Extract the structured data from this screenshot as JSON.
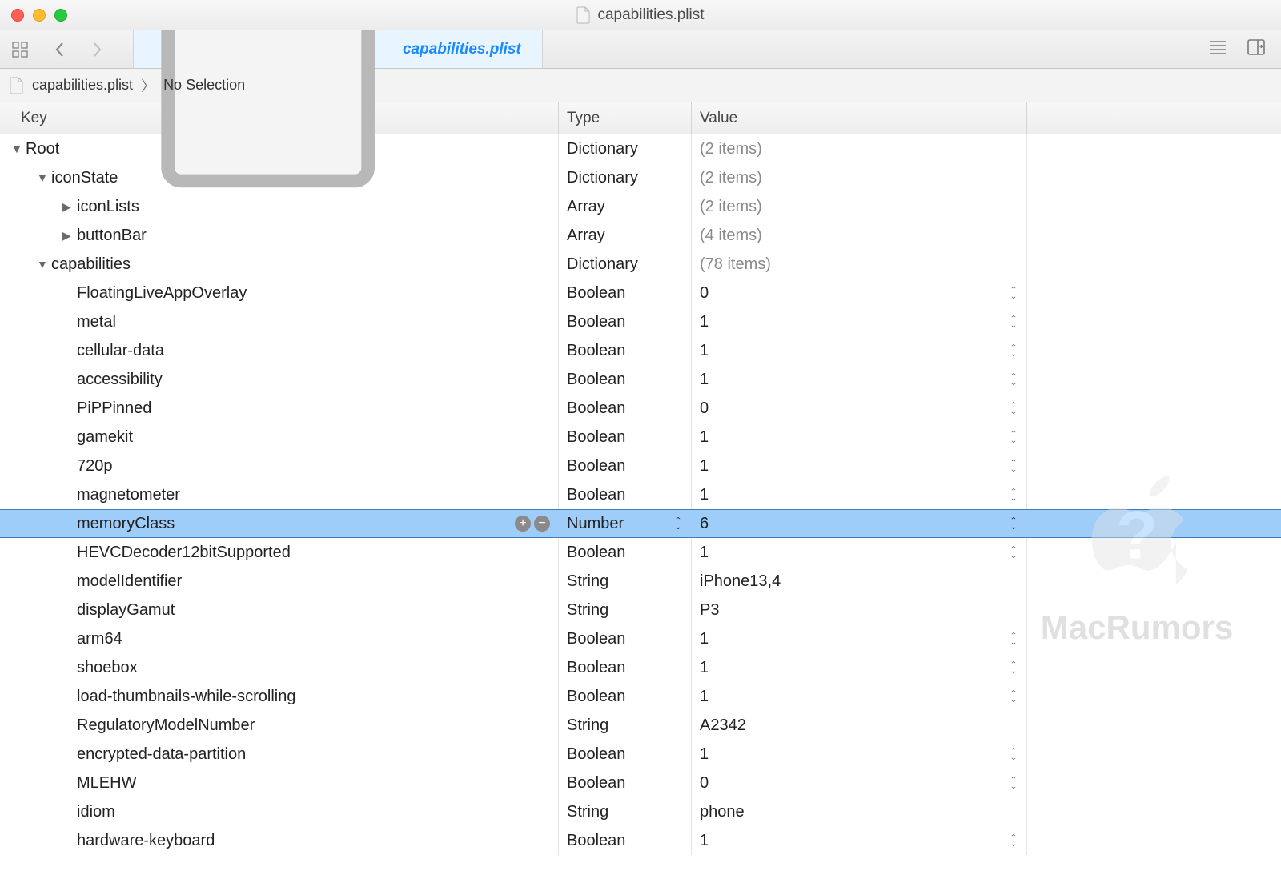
{
  "window": {
    "title": "capabilities.plist"
  },
  "tab": {
    "label": "capabilities.plist"
  },
  "path": {
    "file": "capabilities.plist",
    "selection": "No Selection"
  },
  "columns": {
    "key": "Key",
    "type": "Type",
    "value": "Value"
  },
  "watermark": "MacRumors",
  "selected_key": "memoryClass",
  "rows": [
    {
      "indent": 0,
      "disclosure": "down",
      "key": "Root",
      "type": "Dictionary",
      "value": "(2 items)",
      "value_muted": true,
      "stepper": false
    },
    {
      "indent": 1,
      "disclosure": "down",
      "key": "iconState",
      "type": "Dictionary",
      "value": "(2 items)",
      "value_muted": true,
      "stepper": false
    },
    {
      "indent": 2,
      "disclosure": "right",
      "key": "iconLists",
      "type": "Array",
      "value": "(2 items)",
      "value_muted": true,
      "stepper": false
    },
    {
      "indent": 2,
      "disclosure": "right",
      "key": "buttonBar",
      "type": "Array",
      "value": "(4 items)",
      "value_muted": true,
      "stepper": false
    },
    {
      "indent": 1,
      "disclosure": "down",
      "key": "capabilities",
      "type": "Dictionary",
      "value": "(78 items)",
      "value_muted": true,
      "stepper": false
    },
    {
      "indent": 2,
      "disclosure": "none",
      "key": "FloatingLiveAppOverlay",
      "type": "Boolean",
      "value": "0",
      "value_muted": false,
      "stepper": true
    },
    {
      "indent": 2,
      "disclosure": "none",
      "key": "metal",
      "type": "Boolean",
      "value": "1",
      "value_muted": false,
      "stepper": true
    },
    {
      "indent": 2,
      "disclosure": "none",
      "key": "cellular-data",
      "type": "Boolean",
      "value": "1",
      "value_muted": false,
      "stepper": true
    },
    {
      "indent": 2,
      "disclosure": "none",
      "key": "accessibility",
      "type": "Boolean",
      "value": "1",
      "value_muted": false,
      "stepper": true
    },
    {
      "indent": 2,
      "disclosure": "none",
      "key": "PiPPinned",
      "type": "Boolean",
      "value": "0",
      "value_muted": false,
      "stepper": true
    },
    {
      "indent": 2,
      "disclosure": "none",
      "key": "gamekit",
      "type": "Boolean",
      "value": "1",
      "value_muted": false,
      "stepper": true
    },
    {
      "indent": 2,
      "disclosure": "none",
      "key": "720p",
      "type": "Boolean",
      "value": "1",
      "value_muted": false,
      "stepper": true
    },
    {
      "indent": 2,
      "disclosure": "none",
      "key": "magnetometer",
      "type": "Boolean",
      "value": "1",
      "value_muted": false,
      "stepper": true
    },
    {
      "indent": 2,
      "disclosure": "none",
      "key": "memoryClass",
      "type": "Number",
      "value": "6",
      "value_muted": false,
      "stepper": true,
      "selected": true,
      "type_stepper": true,
      "plusminus": true
    },
    {
      "indent": 2,
      "disclosure": "none",
      "key": "HEVCDecoder12bitSupported",
      "type": "Boolean",
      "value": "1",
      "value_muted": false,
      "stepper": true
    },
    {
      "indent": 2,
      "disclosure": "none",
      "key": "modelIdentifier",
      "type": "String",
      "value": "iPhone13,4",
      "value_muted": false,
      "stepper": false
    },
    {
      "indent": 2,
      "disclosure": "none",
      "key": "displayGamut",
      "type": "String",
      "value": "P3",
      "value_muted": false,
      "stepper": false
    },
    {
      "indent": 2,
      "disclosure": "none",
      "key": "arm64",
      "type": "Boolean",
      "value": "1",
      "value_muted": false,
      "stepper": true
    },
    {
      "indent": 2,
      "disclosure": "none",
      "key": "shoebox",
      "type": "Boolean",
      "value": "1",
      "value_muted": false,
      "stepper": true
    },
    {
      "indent": 2,
      "disclosure": "none",
      "key": "load-thumbnails-while-scrolling",
      "type": "Boolean",
      "value": "1",
      "value_muted": false,
      "stepper": true
    },
    {
      "indent": 2,
      "disclosure": "none",
      "key": "RegulatoryModelNumber",
      "type": "String",
      "value": "A2342",
      "value_muted": false,
      "stepper": false
    },
    {
      "indent": 2,
      "disclosure": "none",
      "key": "encrypted-data-partition",
      "type": "Boolean",
      "value": "1",
      "value_muted": false,
      "stepper": true
    },
    {
      "indent": 2,
      "disclosure": "none",
      "key": "MLEHW",
      "type": "Boolean",
      "value": "0",
      "value_muted": false,
      "stepper": true
    },
    {
      "indent": 2,
      "disclosure": "none",
      "key": "idiom",
      "type": "String",
      "value": "phone",
      "value_muted": false,
      "stepper": false
    },
    {
      "indent": 2,
      "disclosure": "none",
      "key": "hardware-keyboard",
      "type": "Boolean",
      "value": "1",
      "value_muted": false,
      "stepper": true
    }
  ]
}
